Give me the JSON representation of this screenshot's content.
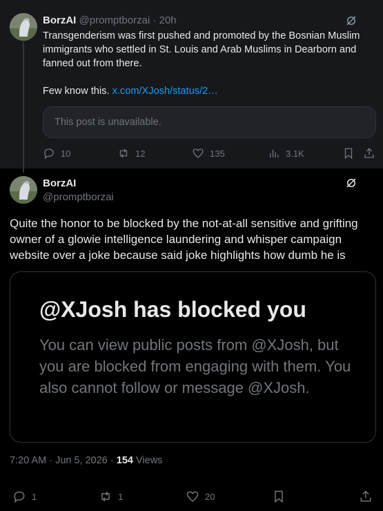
{
  "parent": {
    "author_name": "BorzAI",
    "author_handle": "@promptborzai",
    "separator": " · ",
    "time": "20h",
    "text": "Transgenderism was first pushed and promoted by the Bosnian Muslim immigrants who settled in St. Louis and Arab Muslims in Dearborn and fanned out from there.",
    "text2_prefix": "Few know this. ",
    "link": "x.com/XJosh/status/2…",
    "unavailable": "This post is unavailable.",
    "replies": "10",
    "reposts": "12",
    "likes": "135",
    "views": "3.1K"
  },
  "main": {
    "author_name": "BorzAI",
    "author_handle": "@promptborzai",
    "text": "Quite the honor to be blocked by the not-at-all sensitive and grifting owner of a glowie intelligence laundering and whisper campaign website over a joke because said joke highlights how dumb he is",
    "media_title": "@XJosh has blocked you",
    "media_body": "You can view public posts from @XJosh, but you are blocked from engaging with them. You also cannot follow or message @XJosh.",
    "timestamp": "7:20 AM · Jun 5, 2026 · ",
    "views_count": "154",
    "views_label": " Views",
    "replies": "1",
    "reposts": "1",
    "likes": "20"
  },
  "colors": {
    "background": "#000000",
    "parent_background": "#16181c",
    "accent_link": "#1d9bf0",
    "muted": "#71767b",
    "text": "#e7e9ea"
  },
  "icons": [
    "reply-icon",
    "repost-icon",
    "like-icon",
    "views-icon",
    "bookmark-icon",
    "share-icon",
    "grok-icon"
  ]
}
